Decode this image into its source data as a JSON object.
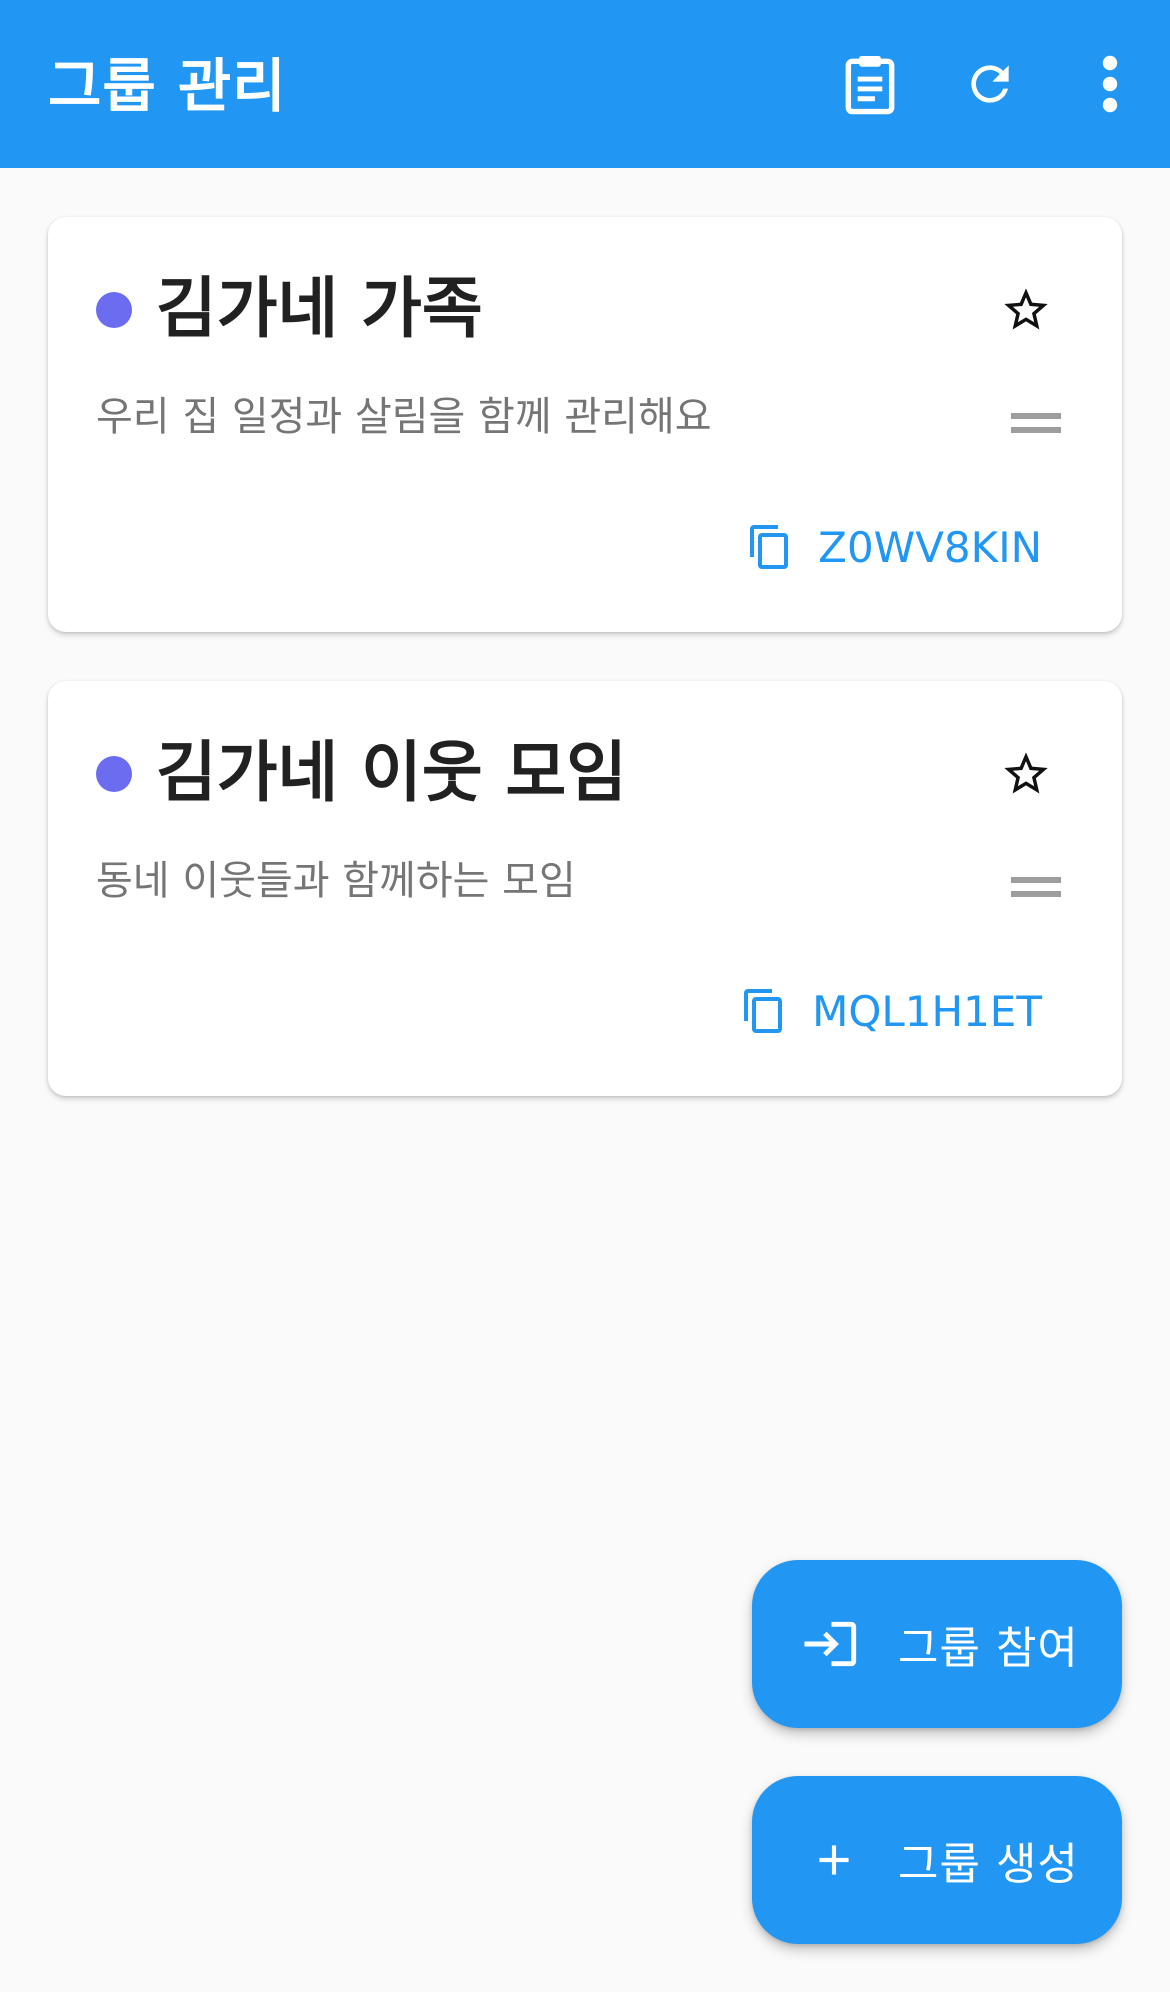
{
  "appbar": {
    "title": "그룹 관리",
    "actions": [
      {
        "icon": "clipboard-icon"
      },
      {
        "icon": "refresh-icon"
      },
      {
        "icon": "more-vert-icon"
      }
    ]
  },
  "groups": [
    {
      "name": "김가네 가족",
      "description": "우리 집 일정과 살림을 함께 관리해요",
      "code": "Z0WV8KIN",
      "color": "#6c6cf0",
      "favorite": false
    },
    {
      "name": "김가네 이웃 모임",
      "description": "동네 이웃들과 함께하는 모임",
      "code": "MQL1H1ET",
      "color": "#6c6cf0",
      "favorite": false
    }
  ],
  "fabs": {
    "join_label": "그룹 참여",
    "create_label": "그룹 생성"
  },
  "colors": {
    "primary": "#2196f3",
    "background": "#fafafa",
    "group_dot": "#6c6cf0"
  }
}
